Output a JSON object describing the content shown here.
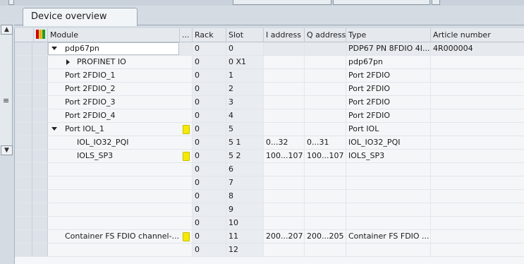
{
  "tab": {
    "title": "Device overview"
  },
  "columns": {
    "module": "Module",
    "dots": "...",
    "rack": "Rack",
    "slot": "Slot",
    "i_address": "I address",
    "q_address": "Q address",
    "type": "Type",
    "article_number": "Article number"
  },
  "rows": [
    {
      "module": "pdp67pn",
      "flag": false,
      "rack": "0",
      "slot": "0",
      "i_address": "",
      "q_address": "",
      "type": "PDP67 PN 8FDIO 4I...",
      "article": "4R000004",
      "indent": 1,
      "toggle": "down",
      "selected": true,
      "editing": true
    },
    {
      "module": "PROFINET IO",
      "flag": false,
      "rack": "0",
      "slot": "0 X1",
      "i_address": "",
      "q_address": "",
      "type": "pdp67pn",
      "article": "",
      "indent": 2,
      "toggle": "right"
    },
    {
      "module": "Port 2FDIO_1",
      "flag": false,
      "rack": "0",
      "slot": "1",
      "i_address": "",
      "q_address": "",
      "type": "Port 2FDIO",
      "article": "",
      "indent": 1,
      "toggle": ""
    },
    {
      "module": "Port 2FDIO_2",
      "flag": false,
      "rack": "0",
      "slot": "2",
      "i_address": "",
      "q_address": "",
      "type": "Port 2FDIO",
      "article": "",
      "indent": 1,
      "toggle": ""
    },
    {
      "module": "Port 2FDIO_3",
      "flag": false,
      "rack": "0",
      "slot": "3",
      "i_address": "",
      "q_address": "",
      "type": "Port 2FDIO",
      "article": "",
      "indent": 1,
      "toggle": ""
    },
    {
      "module": "Port 2FDIO_4",
      "flag": false,
      "rack": "0",
      "slot": "4",
      "i_address": "",
      "q_address": "",
      "type": "Port 2FDIO",
      "article": "",
      "indent": 1,
      "toggle": ""
    },
    {
      "module": "Port IOL_1",
      "flag": true,
      "rack": "0",
      "slot": "5",
      "i_address": "",
      "q_address": "",
      "type": "Port IOL",
      "article": "",
      "indent": 1,
      "toggle": "down"
    },
    {
      "module": "IOL_IO32_PQI",
      "flag": false,
      "rack": "0",
      "slot": "5 1",
      "i_address": "0...32",
      "q_address": "0...31",
      "type": "IOL_IO32_PQI",
      "article": "",
      "indent": 2,
      "toggle": ""
    },
    {
      "module": "IOLS_SP3",
      "flag": true,
      "rack": "0",
      "slot": "5 2",
      "i_address": "100...107",
      "q_address": "100...107",
      "type": "IOLS_SP3",
      "article": "",
      "indent": 2,
      "toggle": ""
    },
    {
      "module": "",
      "flag": false,
      "rack": "0",
      "slot": "6",
      "i_address": "",
      "q_address": "",
      "type": "",
      "article": "",
      "indent": 0,
      "toggle": ""
    },
    {
      "module": "",
      "flag": false,
      "rack": "0",
      "slot": "7",
      "i_address": "",
      "q_address": "",
      "type": "",
      "article": "",
      "indent": 0,
      "toggle": ""
    },
    {
      "module": "",
      "flag": false,
      "rack": "0",
      "slot": "8",
      "i_address": "",
      "q_address": "",
      "type": "",
      "article": "",
      "indent": 0,
      "toggle": ""
    },
    {
      "module": "",
      "flag": false,
      "rack": "0",
      "slot": "9",
      "i_address": "",
      "q_address": "",
      "type": "",
      "article": "",
      "indent": 0,
      "toggle": ""
    },
    {
      "module": "",
      "flag": false,
      "rack": "0",
      "slot": "10",
      "i_address": "",
      "q_address": "",
      "type": "",
      "article": "",
      "indent": 0,
      "toggle": ""
    },
    {
      "module": "Container FS FDIO channel-...",
      "flag": true,
      "rack": "0",
      "slot": "11",
      "i_address": "200...207",
      "q_address": "200...205",
      "type": "Container FS FDIO ...",
      "article": "",
      "indent": 1,
      "toggle": ""
    },
    {
      "module": "",
      "flag": false,
      "rack": "0",
      "slot": "12",
      "i_address": "",
      "q_address": "",
      "type": "",
      "article": "",
      "indent": 0,
      "toggle": ""
    }
  ],
  "icons": {
    "rail_up": "chevron-up-icon",
    "rail_down": "chevron-down-icon",
    "rail_menu": "menu-icon",
    "filter": "filter-icon"
  }
}
